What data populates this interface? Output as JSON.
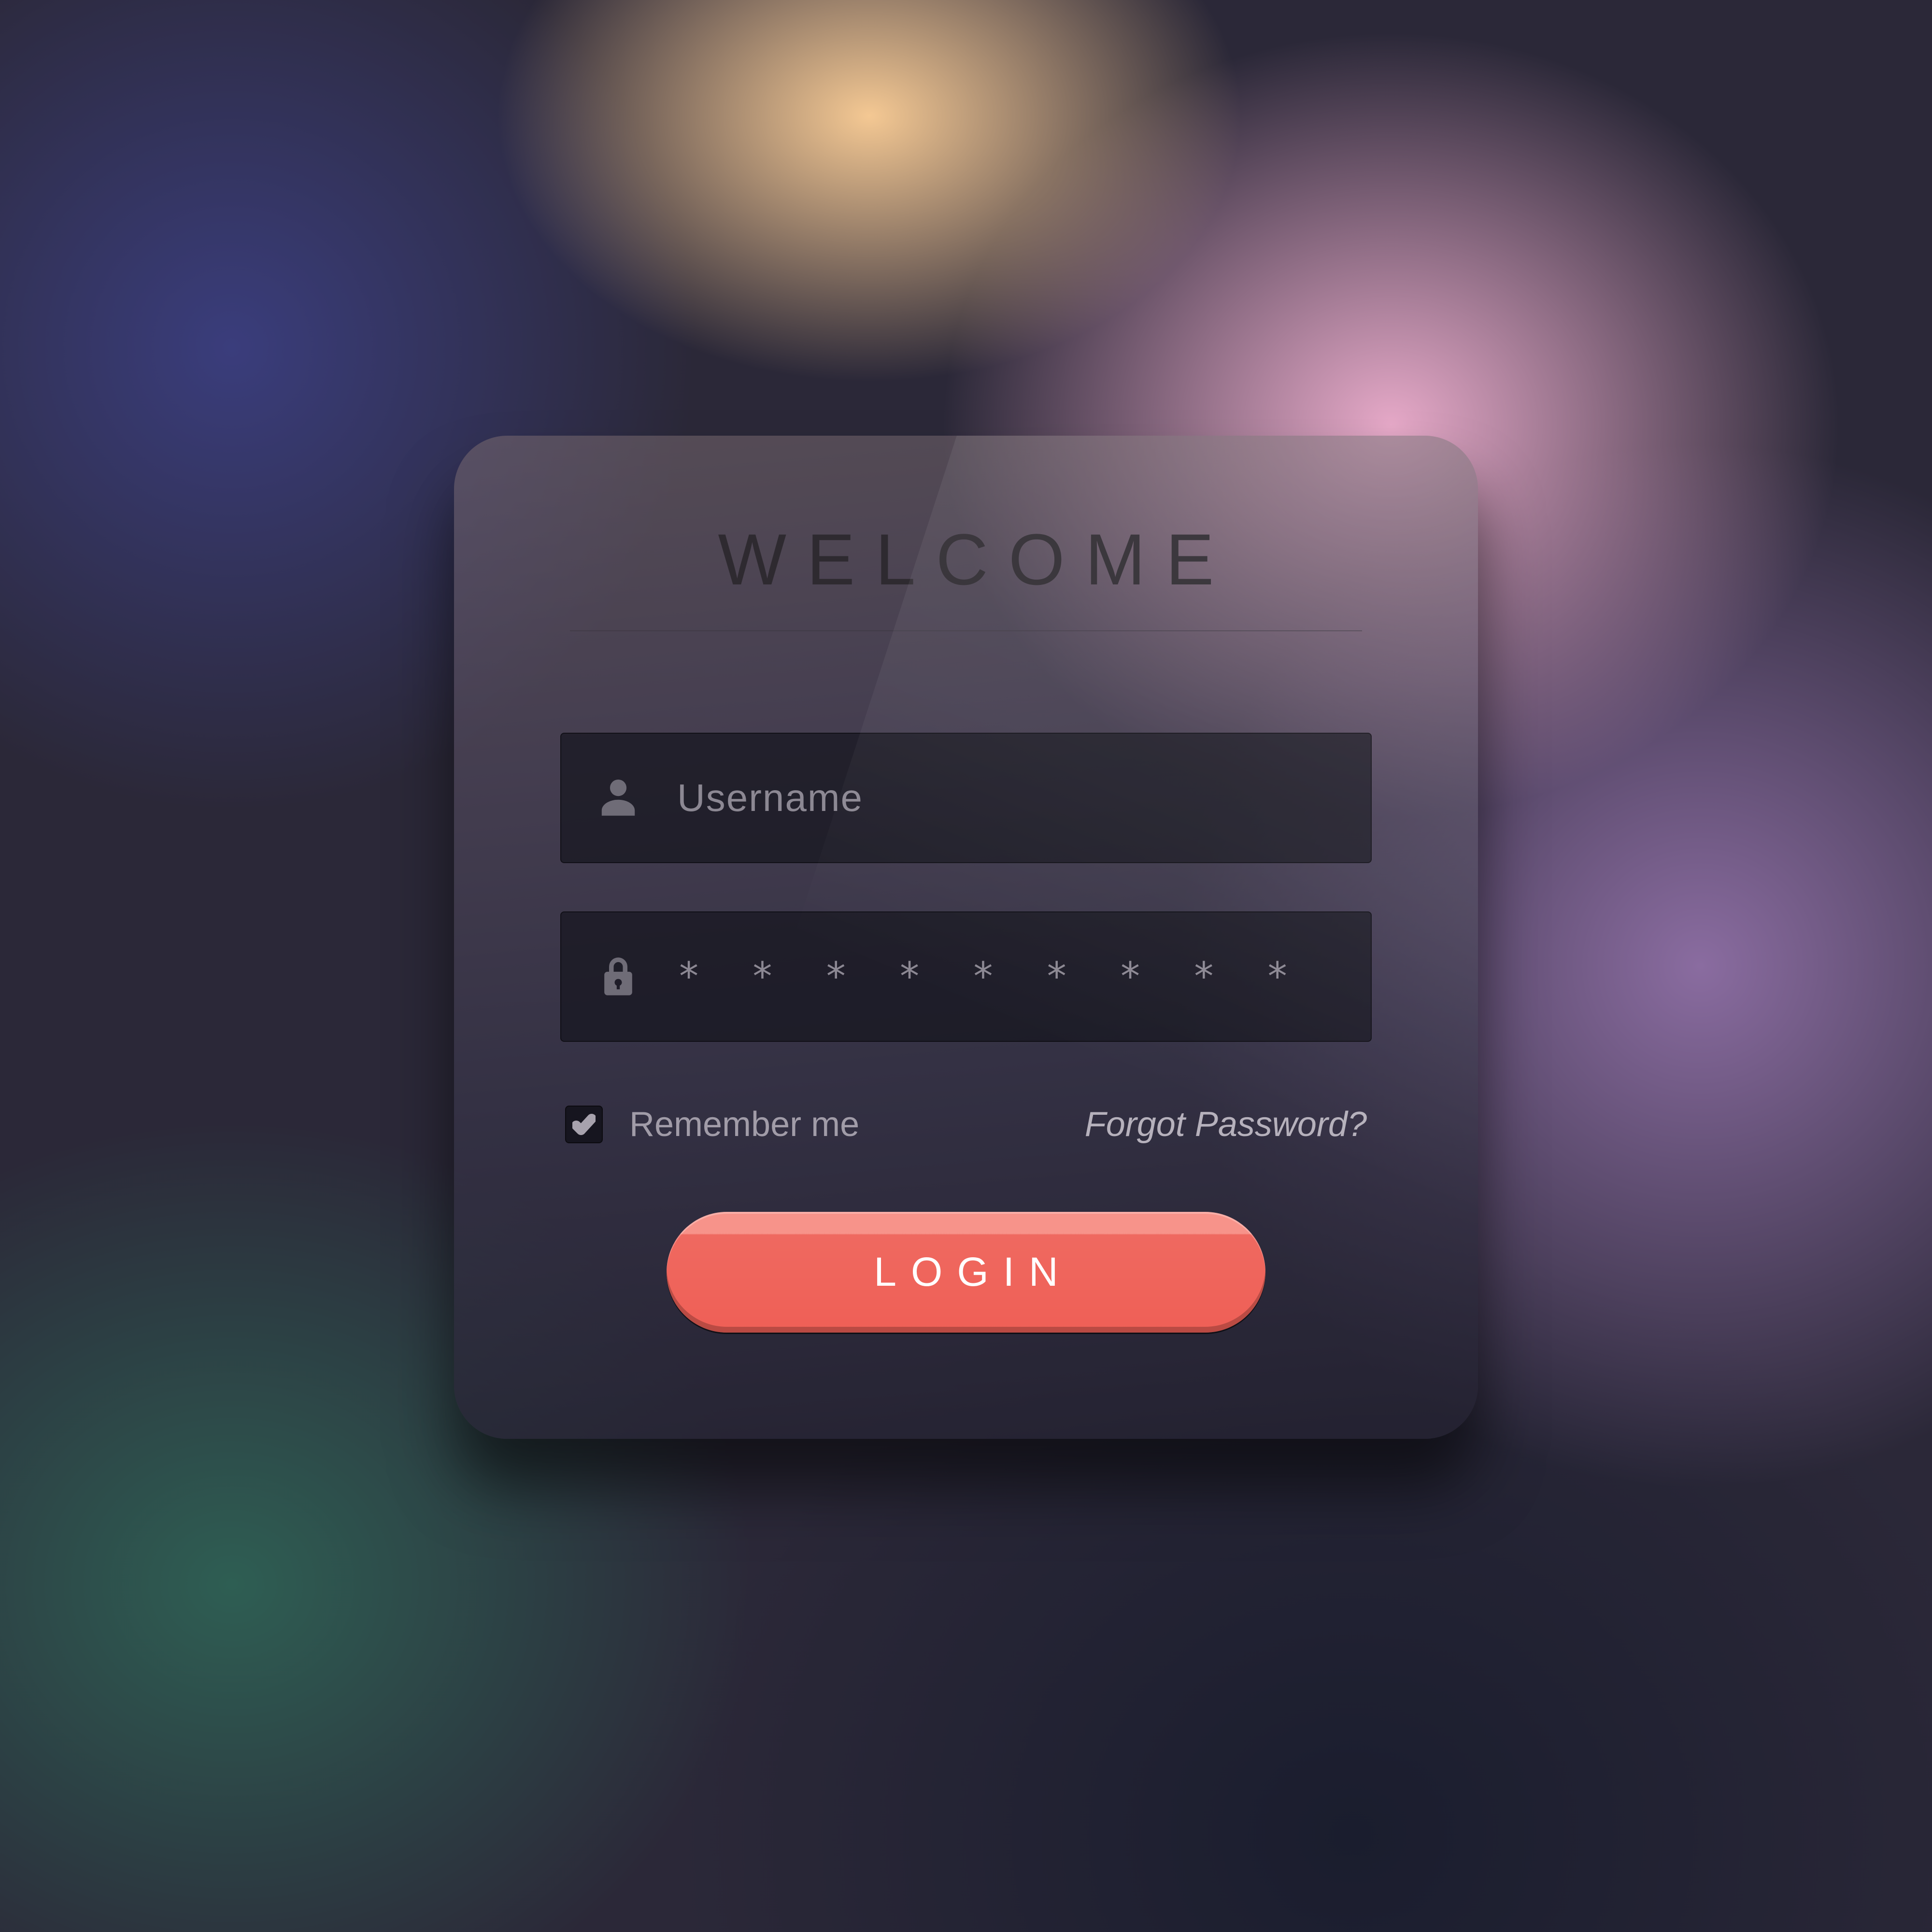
{
  "card": {
    "title": "WELCOME",
    "username": {
      "placeholder": "Username",
      "value": ""
    },
    "password": {
      "mask": "* * * * * * * * *",
      "value": ""
    },
    "remember": {
      "label": "Remember me",
      "checked": true
    },
    "forgot_label": "Forgot Password?",
    "login_label": "LOGIN"
  },
  "colors": {
    "accent": "#ef5f56"
  }
}
